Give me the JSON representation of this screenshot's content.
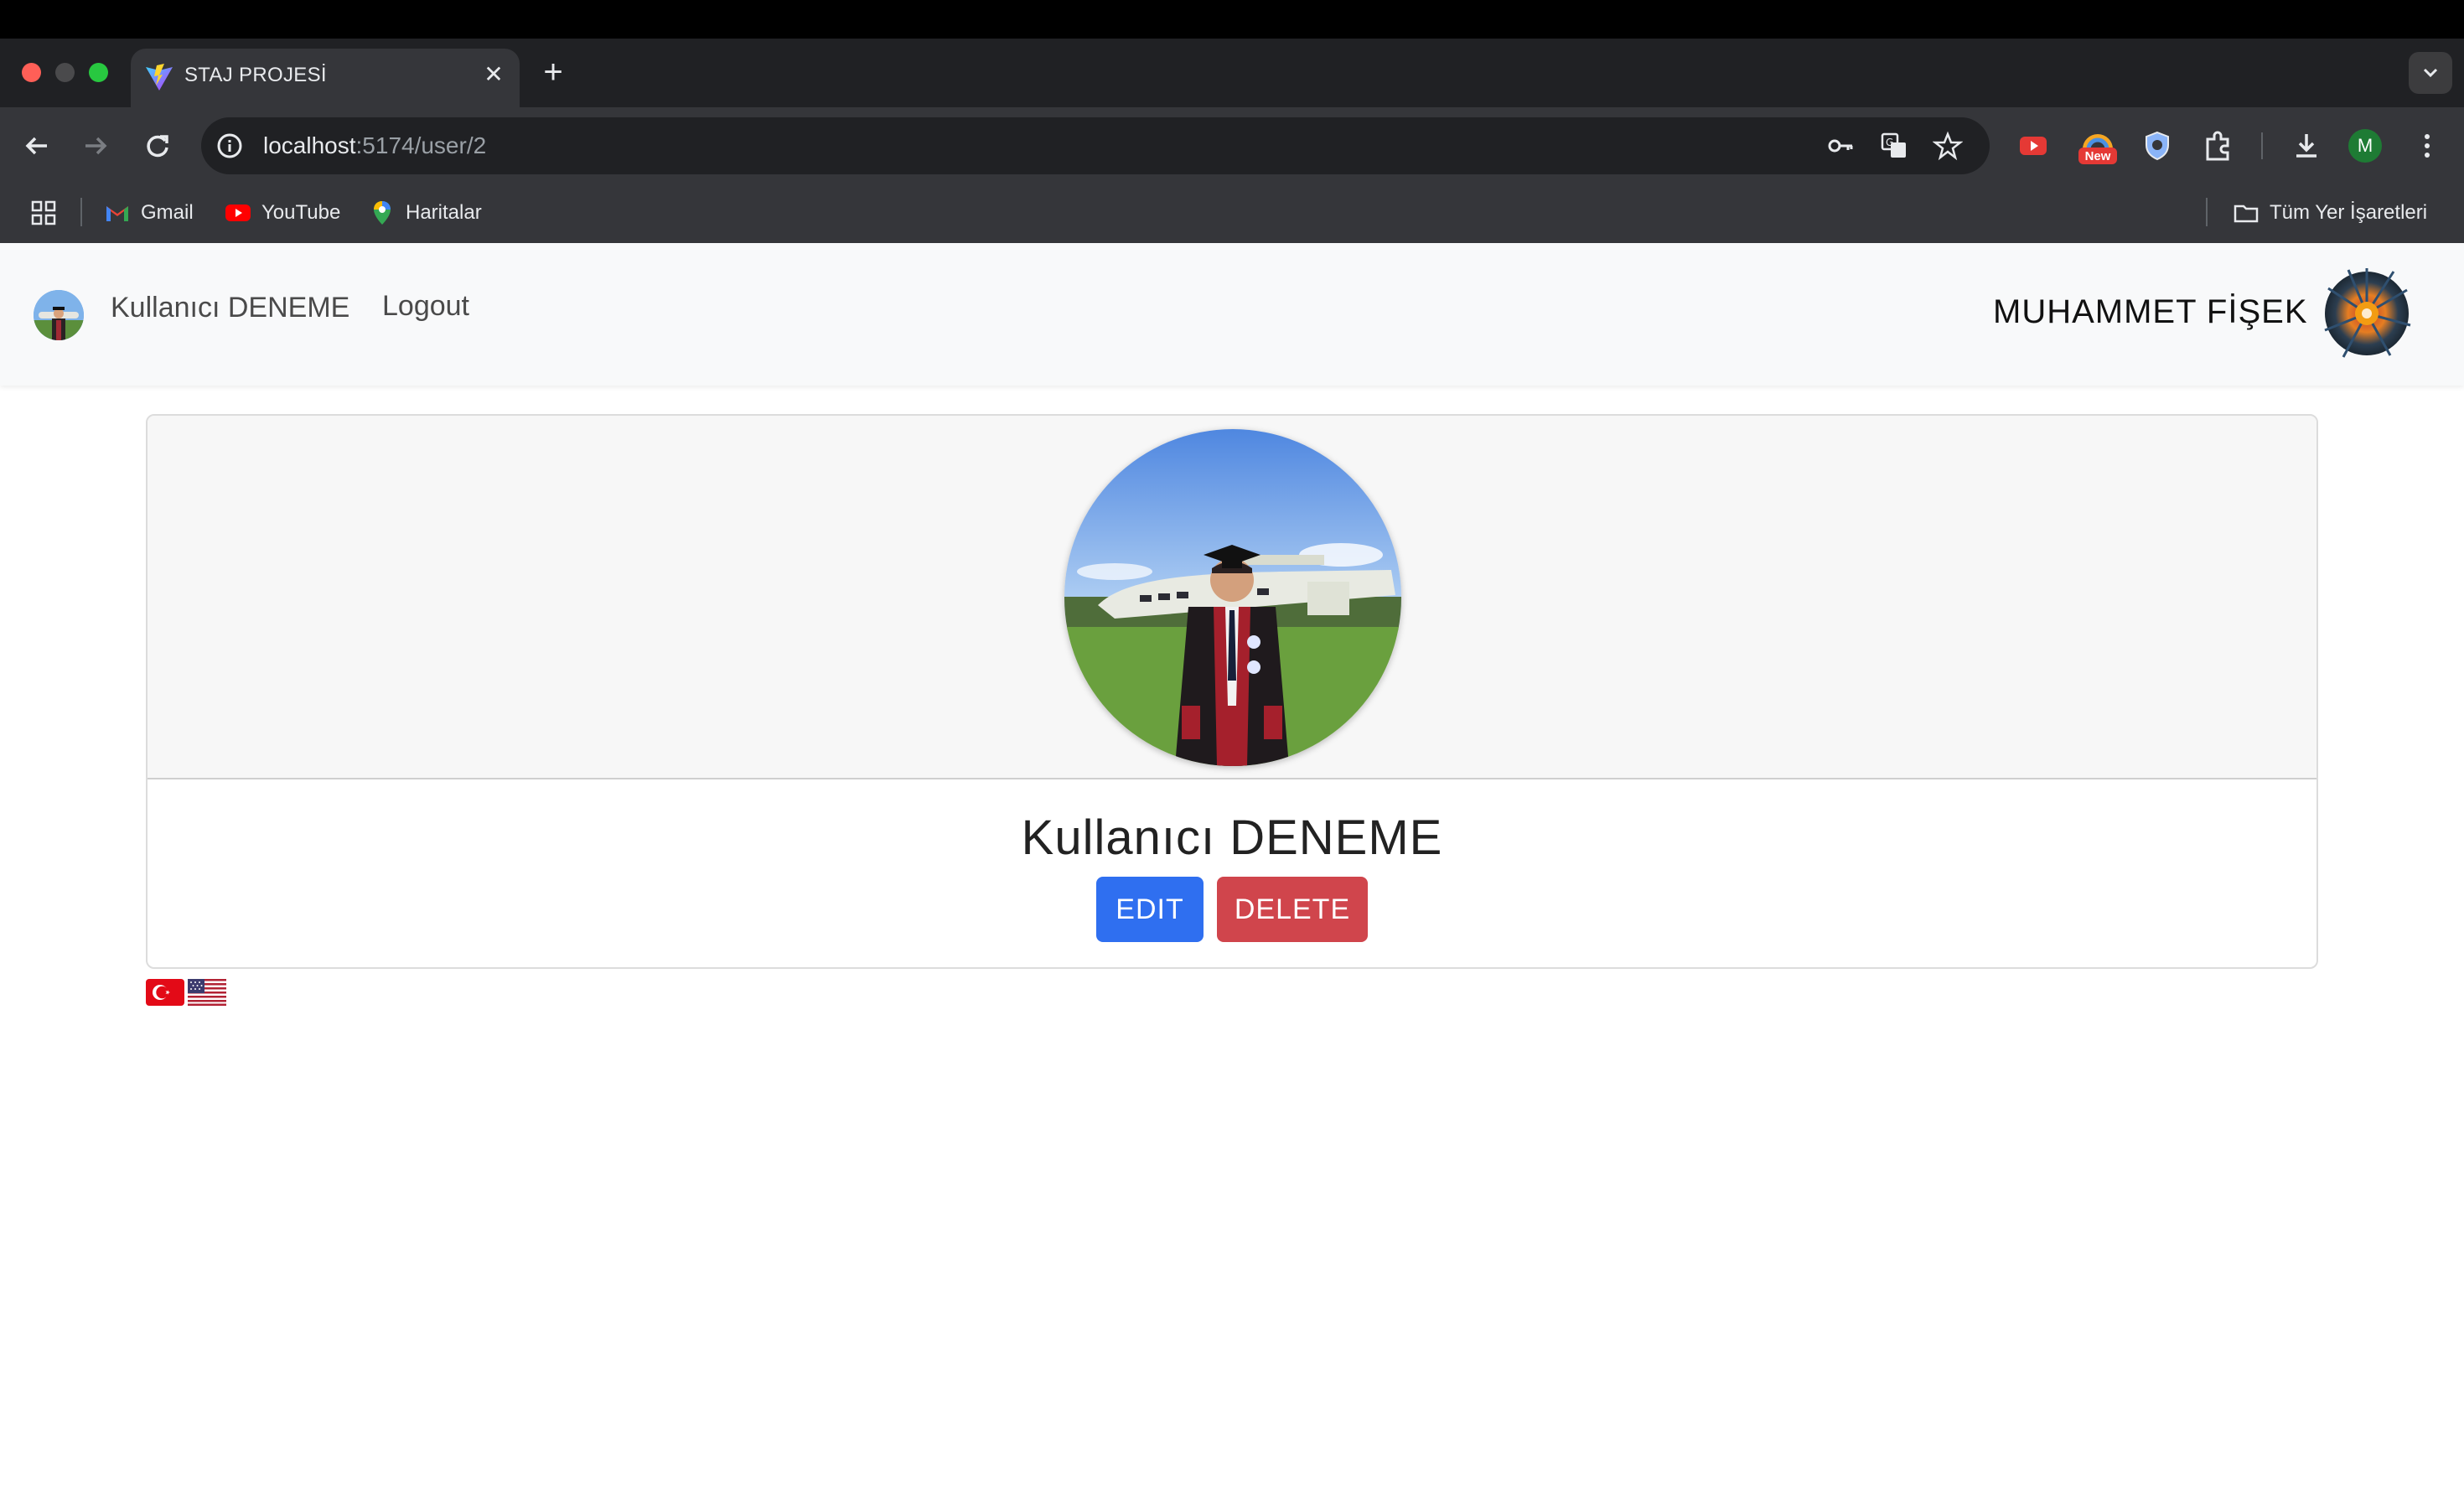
{
  "browser": {
    "tab_title": "STAJ PROJESİ",
    "new_tab": "+",
    "close": "✕",
    "url_host": "localhost",
    "url_rest": ":5174/user/2",
    "extension_badge": "New",
    "profile_initial": "M",
    "bookmarks": [
      {
        "label": "Gmail"
      },
      {
        "label": "YouTube"
      },
      {
        "label": "Haritalar"
      }
    ],
    "all_bookmarks": "Tüm Yer İşaretleri"
  },
  "navbar": {
    "user_link": "Kullanıcı DENEME",
    "logout": "Logout",
    "brand": "MUHAMMET FİŞEK"
  },
  "card": {
    "name": "Kullanıcı DENEME",
    "edit_label": "EDIT",
    "delete_label": "DELETE"
  },
  "languages": [
    "tr",
    "en-US"
  ],
  "colors": {
    "edit_button": "#2f6ff0",
    "delete_button": "#d0454c",
    "navbar_bg": "#f8f9fa"
  }
}
